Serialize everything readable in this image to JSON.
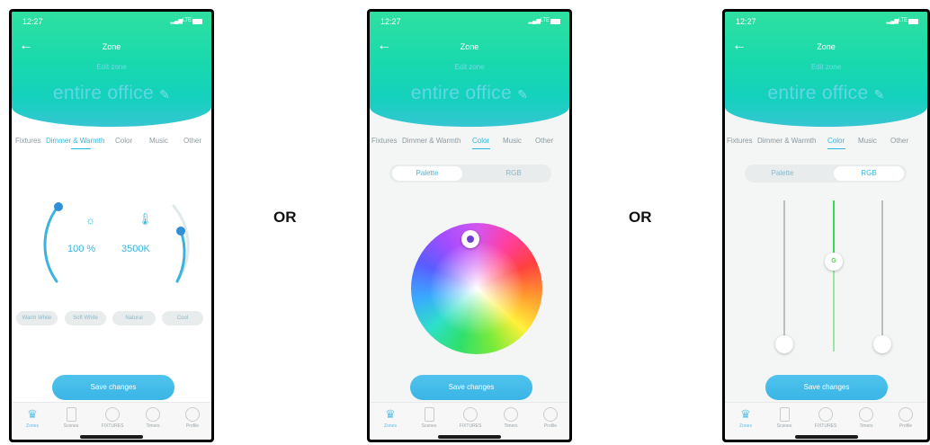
{
  "separator": "OR",
  "status": {
    "time": "12:27",
    "network": "LTE"
  },
  "header": {
    "title": "Zone",
    "edit_link": "Edit zone",
    "zone_name": "entire office"
  },
  "tabs": [
    "Fixtures",
    "Dimmer & Warmth",
    "Color",
    "Music",
    "Other"
  ],
  "screens": [
    {
      "active_tab": "Dimmer & Warmth"
    },
    {
      "active_tab": "Color",
      "segment": [
        "Palette",
        "RGB"
      ],
      "segment_selected": "Palette"
    },
    {
      "active_tab": "Color",
      "segment": [
        "Palette",
        "RGB"
      ],
      "segment_selected": "RGB",
      "slider_label": "G"
    }
  ],
  "dimmer": {
    "brightness": "100 %",
    "temperature": "3500K"
  },
  "presets": [
    "Warm White",
    "Soft White",
    "Natural",
    "Cool"
  ],
  "save_label": "Save changes",
  "nav": [
    "Zones",
    "Scenes",
    "FIXTURES",
    "Timers",
    "Profile"
  ],
  "colors": {
    "accent": "#3ab5e6",
    "header_top": "#2fe0a0",
    "header_bottom": "#36c6d2",
    "rgb_green": "#3ddc4a"
  },
  "icons": {
    "brightness": "sun-icon",
    "temperature": "thermometer-icon",
    "edit": "pencil-icon",
    "back": "arrow-left-icon"
  }
}
